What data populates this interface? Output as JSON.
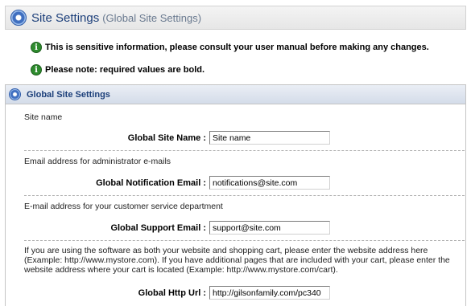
{
  "header": {
    "title": "Site Settings",
    "subtitle": "(Global Site Settings)",
    "icon": "gear-icon"
  },
  "notices": [
    "This is sensitive information, please consult your user manual before making any changes.",
    "Please note: required values are bold."
  ],
  "panel": {
    "title": "Global Site Settings",
    "fields": [
      {
        "description": "Site name",
        "label": "Global Site Name :",
        "value": "Site name"
      },
      {
        "description": "Email address for administrator e-mails",
        "label": "Global Notification Email :",
        "value": "notifications@site.com"
      },
      {
        "description": "E-mail address for your customer service department",
        "label": "Global Support Email :",
        "value": "support@site.com"
      },
      {
        "description": "If you are using the software as both your website and shopping cart, please enter the website address here (Example: http://www.mystore.com). If you have additional pages that are included with your cart, please enter the website address where your cart is located (Example: http://www.mystore.com/cart).",
        "label": "Global Http Url :",
        "value": "http://gilsonfamily.com/pc340"
      }
    ]
  }
}
